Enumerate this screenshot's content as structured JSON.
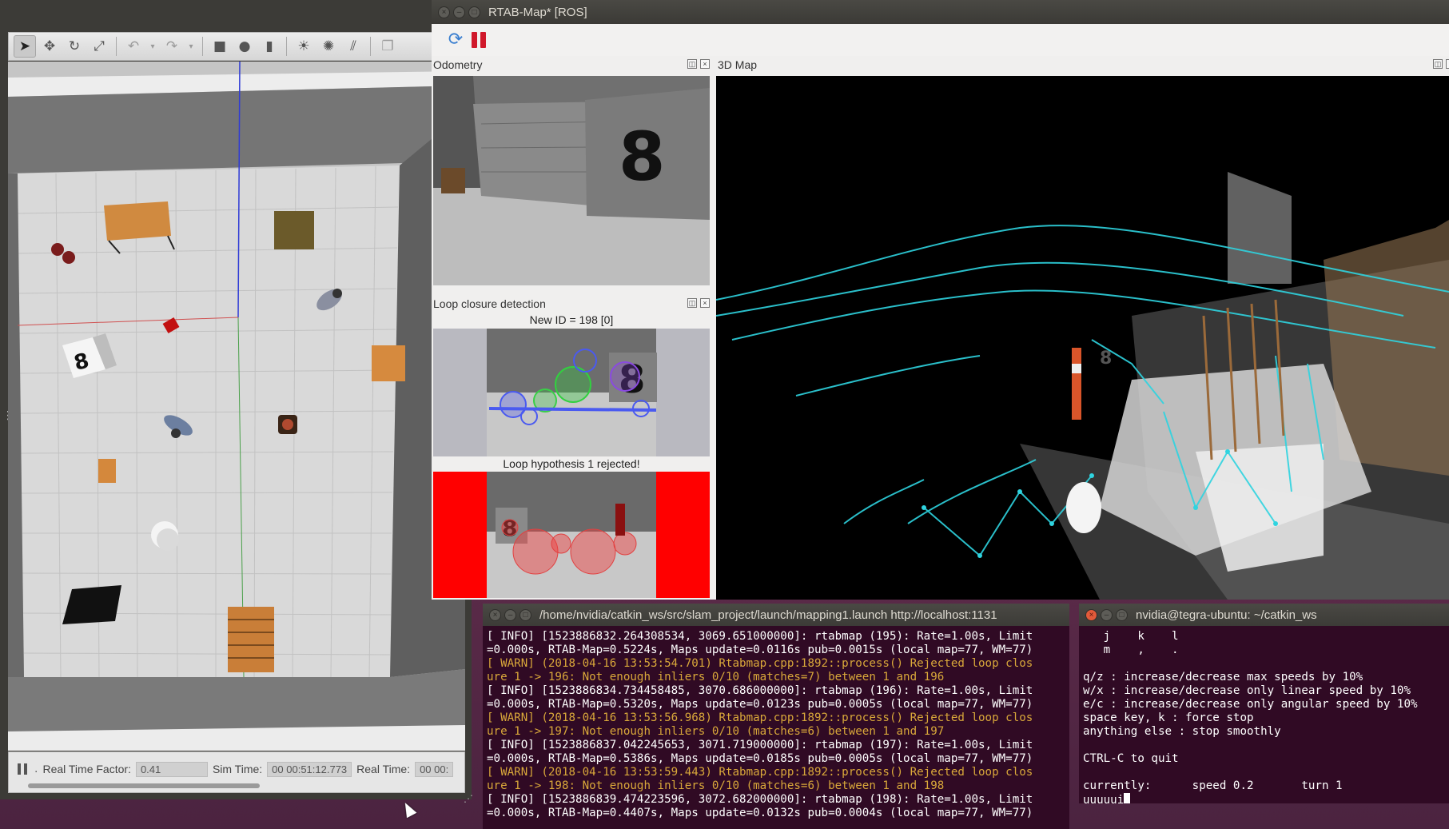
{
  "gazebo": {
    "toolbar": {
      "tools": [
        "select-icon",
        "translate-icon",
        "rotate-icon",
        "scale-icon"
      ],
      "history": [
        "undo-icon",
        "redo-icon"
      ],
      "shapes": [
        "box-icon",
        "sphere-icon",
        "cylinder-icon"
      ],
      "lights": [
        "sun-icon",
        "point-light-icon",
        "directional-light-icon"
      ]
    },
    "status": {
      "rtf_label": "Real Time Factor:",
      "rtf_value": "0.41",
      "sim_label": "Sim Time:",
      "sim_value": "00 00:51:12.773",
      "real_label": "Real Time:",
      "real_value": "00 00:"
    },
    "scene": {
      "cube_digit": "8"
    }
  },
  "rtabmap": {
    "title": "RTAB-Map* [ROS]",
    "odometry_title": "Odometry",
    "odometry_sign": "8",
    "map3d_title": "3D Map",
    "loop_title": "Loop closure detection",
    "new_id": "New ID = 198 [0]",
    "loop_status": "Loop hypothesis 1 rejected!",
    "sign_digit": "8",
    "colors": {
      "cloud_cyan": "#2fd4e0",
      "reject_red": "#ff0000"
    }
  },
  "terminal_log": {
    "title": "/home/nvidia/catkin_ws/src/slam_project/launch/mapping1.launch http://localhost:1131",
    "lines": [
      {
        "type": "info",
        "text": "[ INFO] [1523886832.264308534, 3069.651000000]: rtabmap (195): Rate=1.00s, Limit"
      },
      {
        "type": "info",
        "text": "=0.000s, RTAB-Map=0.5224s, Maps update=0.0116s pub=0.0015s (local map=77, WM=77)"
      },
      {
        "type": "warn",
        "text": "[ WARN] (2018-04-16 13:53:54.701) Rtabmap.cpp:1892::process() Rejected loop clos"
      },
      {
        "type": "warn",
        "text": "ure 1 -> 196: Not enough inliers 0/10 (matches=7) between 1 and 196"
      },
      {
        "type": "info",
        "text": "[ INFO] [1523886834.734458485, 3070.686000000]: rtabmap (196): Rate=1.00s, Limit"
      },
      {
        "type": "info",
        "text": "=0.000s, RTAB-Map=0.5320s, Maps update=0.0123s pub=0.0005s (local map=77, WM=77)"
      },
      {
        "type": "warn",
        "text": "[ WARN] (2018-04-16 13:53:56.968) Rtabmap.cpp:1892::process() Rejected loop clos"
      },
      {
        "type": "warn",
        "text": "ure 1 -> 197: Not enough inliers 0/10 (matches=6) between 1 and 197"
      },
      {
        "type": "info",
        "text": "[ INFO] [1523886837.042245653, 3071.719000000]: rtabmap (197): Rate=1.00s, Limit"
      },
      {
        "type": "info",
        "text": "=0.000s, RTAB-Map=0.5386s, Maps update=0.0185s pub=0.0005s (local map=77, WM=77)"
      },
      {
        "type": "warn",
        "text": "[ WARN] (2018-04-16 13:53:59.443) Rtabmap.cpp:1892::process() Rejected loop clos"
      },
      {
        "type": "warn",
        "text": "ure 1 -> 198: Not enough inliers 0/10 (matches=6) between 1 and 198"
      },
      {
        "type": "info",
        "text": "[ INFO] [1523886839.474223596, 3072.682000000]: rtabmap (198): Rate=1.00s, Limit"
      },
      {
        "type": "info",
        "text": "=0.000s, RTAB-Map=0.4407s, Maps update=0.0132s pub=0.0004s (local map=77, WM=77)"
      }
    ]
  },
  "terminal_teleop": {
    "title": "nvidia@tegra-ubuntu: ~/catkin_ws",
    "lines": [
      "   j    k    l",
      "   m    ,    .",
      "",
      "q/z : increase/decrease max speeds by 10%",
      "w/x : increase/decrease only linear speed by 10%",
      "e/c : increase/decrease only angular speed by 10%",
      "space key, k : force stop",
      "anything else : stop smoothly",
      "",
      "CTRL-C to quit",
      "",
      "currently:      speed 0.2       turn 1 "
    ],
    "input": "uuuuui"
  }
}
